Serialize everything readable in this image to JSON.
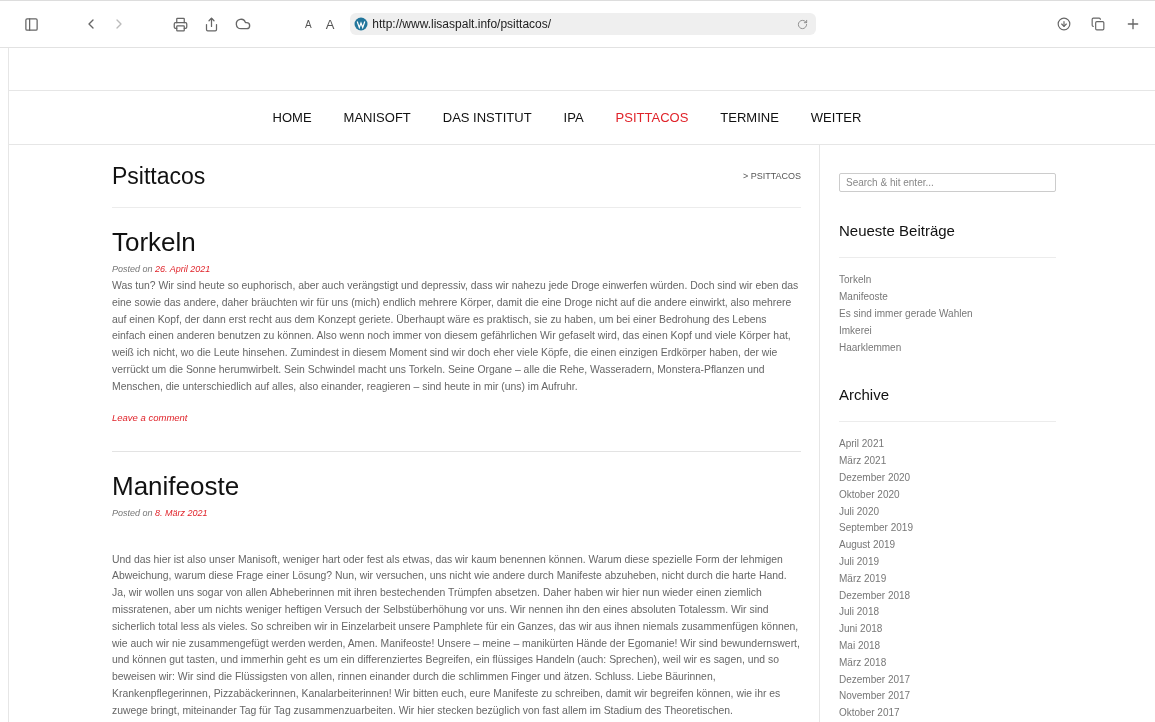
{
  "browser": {
    "font_small": "A",
    "font_large": "A",
    "url": "http://www.lisaspalt.info/psittacos/"
  },
  "nav": [
    {
      "label": "HOME",
      "selected": false
    },
    {
      "label": "MANISOFT",
      "selected": false
    },
    {
      "label": "DAS INSTITUT",
      "selected": false
    },
    {
      "label": "IPA",
      "selected": false
    },
    {
      "label": "PSITTACOS",
      "selected": true
    },
    {
      "label": "TERMINE",
      "selected": false
    },
    {
      "label": "WEITER",
      "selected": false
    }
  ],
  "page_title": "Psittacos",
  "breadcrumb": "> PSITTACOS",
  "posts": [
    {
      "title": "Torkeln",
      "posted_on": "Posted on",
      "date": "26. April 2021",
      "body": "Was tun? Wir sind heute so euphorisch, aber auch verängstigt und depressiv, dass wir nahezu jede Droge einwerfen würden. Doch sind wir eben das eine sowie das andere, daher bräuchten wir für uns (mich) endlich mehrere Körper, damit die eine Droge nicht auf die andere einwirkt, also mehrere auf einen Kopf, der dann erst recht aus dem Konzept geriete. Überhaupt wäre es praktisch, sie zu haben, um bei einer Bedrohung des Lebens einfach einen anderen benutzen zu können. Also wenn noch immer von diesem gefährlichen Wir gefaselt wird, das einen Kopf und viele Körper hat, weiß ich nicht, wo die Leute hinsehen. Zumindest in diesem Moment sind wir doch eher viele Köpfe, die einen einzigen Erdkörper haben, der wie verrückt um die Sonne herumwirbelt. Sein Schwindel macht uns Torkeln. Seine Organe – alle die Rehe, Wasseradern, Monstera-Pflanzen und Menschen, die unterschiedlich auf alles, also einander, reagieren – sind heute in mir (uns) im Aufruhr.",
      "comment": "Leave a comment"
    },
    {
      "title": "Manifeoste",
      "posted_on": "Posted on",
      "date": "8. März 2021",
      "body": "Und das hier ist also unser Manisoft, weniger hart oder fest als etwas, das wir kaum benennen können. Warum diese spezielle Form der lehmigen Abweichung, warum diese Frage einer Lösung? Nun, wir versuchen, uns nicht wie andere durch Manifeste abzuheben, nicht durch die harte Hand. Ja, wir wollen uns sogar von allen Abheberinnen mit ihren bestechenden Trümpfen absetzen. Daher haben wir hier nun wieder einen ziemlich missratenen, aber um nichts weniger heftigen Versuch der Selbstüberhöhung vor uns. Wir nennen ihn den eines absoluten Totalessm. Wir sind sicherlich total less als vieles. So schreiben wir in Einzelarbeit unsere Pamphlete für ein Ganzes, das wir aus ihnen niemals zusammenfügen können, wie auch wir nie zusammengefügt werden werden, Amen. Manifeoste! Unsere – meine – manikürten Hände der Egomanie! Wir sind bewundernswert, und können gut tasten, und immerhin geht es um ein differenziertes Begreifen, ein flüssiges Handeln (auch: Sprechen), weil wir es sagen, und so beweisen wir: Wir sind die Flüssigsten von allen, rinnen einander durch die schlimmen Finger und ätzen. Schluss. Liebe Bäurinnen, Krankenpflegerinnen, Pizzabäckerinnen, Kanalarbeiterinnen! Wir bitten euch, eure Manifeste zu schreiben, damit wir begreifen können, wie ihr es zuwege bringt, miteinander Tag für Tag zusammenzuarbeiten. Wir hier stecken bezüglich von fast allem im Stadium des Theoretischen."
    }
  ],
  "sidebar": {
    "search": {
      "placeholder": "Search & hit enter..."
    },
    "recent_title": "Neueste Beiträge",
    "recent": [
      "Torkeln",
      "Manifeoste",
      "Es sind immer gerade Wahlen",
      "Imkerei",
      "Haarklemmen"
    ],
    "archive_title": "Archive",
    "archive": [
      "April 2021",
      "März 2021",
      "Dezember 2020",
      "Oktober 2020",
      "Juli 2020",
      "September 2019",
      "August 2019",
      "Juli 2019",
      "März 2019",
      "Dezember 2018",
      "Juli 2018",
      "Juni 2018",
      "Mai 2018",
      "März 2018",
      "Dezember 2017",
      "November 2017",
      "Oktober 2017"
    ]
  }
}
